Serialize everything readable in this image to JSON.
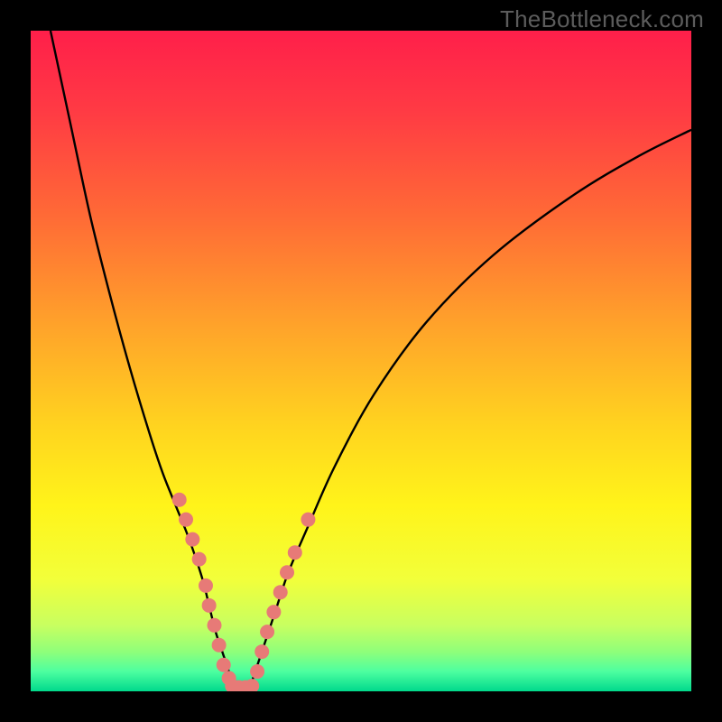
{
  "watermark": "TheBottleneck.com",
  "colors": {
    "bg_black": "#000000",
    "curve_black": "#000000",
    "dot_fill": "#e77a77",
    "gradient_stops": [
      {
        "offset": 0.0,
        "color": "#ff1f4a"
      },
      {
        "offset": 0.12,
        "color": "#ff3a44"
      },
      {
        "offset": 0.28,
        "color": "#ff6a36"
      },
      {
        "offset": 0.45,
        "color": "#ffa42a"
      },
      {
        "offset": 0.6,
        "color": "#ffd41f"
      },
      {
        "offset": 0.72,
        "color": "#fff41a"
      },
      {
        "offset": 0.83,
        "color": "#f2ff3a"
      },
      {
        "offset": 0.9,
        "color": "#c8ff60"
      },
      {
        "offset": 0.94,
        "color": "#8fff7a"
      },
      {
        "offset": 0.97,
        "color": "#4dffa0"
      },
      {
        "offset": 1.0,
        "color": "#00d98c"
      }
    ]
  },
  "chart_data": {
    "type": "line",
    "title": "",
    "xlabel": "",
    "ylabel": "",
    "xlim": [
      0,
      100
    ],
    "ylim": [
      0,
      100
    ],
    "series": [
      {
        "name": "left_curve",
        "x": [
          3,
          6,
          9,
          12,
          15,
          18,
          20,
          22,
          24,
          26,
          27,
          28,
          29,
          30,
          31
        ],
        "y": [
          100,
          86,
          72,
          60,
          49,
          39,
          33,
          28,
          23,
          17,
          13,
          9,
          6,
          3,
          0
        ]
      },
      {
        "name": "right_curve",
        "x": [
          33,
          34,
          35,
          37,
          39,
          42,
          46,
          52,
          60,
          70,
          82,
          92,
          100
        ],
        "y": [
          0,
          3,
          6,
          12,
          18,
          25,
          34,
          45,
          56,
          66,
          75,
          81,
          85
        ]
      }
    ],
    "points_left": [
      {
        "x": 22.5,
        "y": 29
      },
      {
        "x": 23.5,
        "y": 26
      },
      {
        "x": 24.5,
        "y": 23
      },
      {
        "x": 25.5,
        "y": 20
      },
      {
        "x": 26.5,
        "y": 16
      },
      {
        "x": 27.0,
        "y": 13
      },
      {
        "x": 27.8,
        "y": 10
      },
      {
        "x": 28.5,
        "y": 7
      },
      {
        "x": 29.2,
        "y": 4
      },
      {
        "x": 30.0,
        "y": 2
      }
    ],
    "points_bottom": [
      {
        "x": 30.5,
        "y": 0.8
      },
      {
        "x": 31.5,
        "y": 0.6
      },
      {
        "x": 32.5,
        "y": 0.6
      },
      {
        "x": 33.5,
        "y": 0.8
      }
    ],
    "points_right": [
      {
        "x": 34.3,
        "y": 3
      },
      {
        "x": 35.0,
        "y": 6
      },
      {
        "x": 35.8,
        "y": 9
      },
      {
        "x": 36.8,
        "y": 12
      },
      {
        "x": 37.8,
        "y": 15
      },
      {
        "x": 38.8,
        "y": 18
      },
      {
        "x": 40.0,
        "y": 21
      },
      {
        "x": 42.0,
        "y": 26
      }
    ]
  }
}
